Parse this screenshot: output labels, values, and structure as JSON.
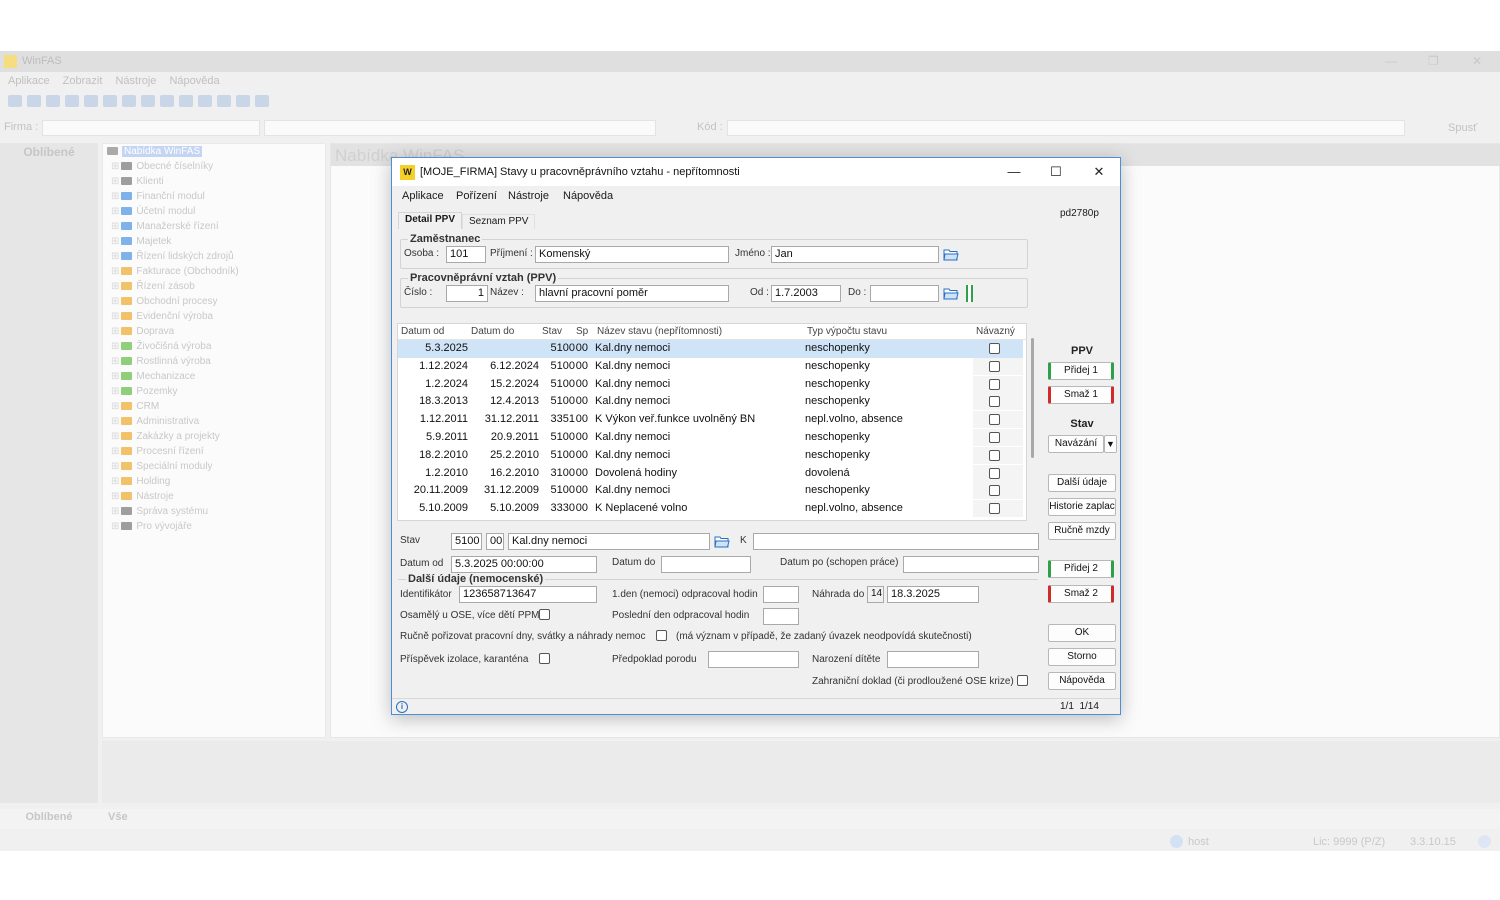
{
  "bg": {
    "title": "WinFAS",
    "menu": [
      "Aplikace",
      "Zobrazit",
      "Nástroje",
      "Nápověda"
    ],
    "firma_label": "Firma :",
    "kod_label": "Kód :",
    "spust_label": "Spusť",
    "oblibene": "Oblíbené",
    "tree_root": "Nabídka WinFAS",
    "tree": [
      {
        "label": "Obecné číselníky",
        "color": "#9e9e9e"
      },
      {
        "label": "Klienti",
        "color": "#9e9e9e"
      },
      {
        "label": "Finanční modul",
        "color": "#7fb2e8"
      },
      {
        "label": "Účetní modul",
        "color": "#7fb2e8"
      },
      {
        "label": "Manažerské řízení",
        "color": "#7fb2e8"
      },
      {
        "label": "Majetek",
        "color": "#7fb2e8"
      },
      {
        "label": "Řízení lidských zdrojů",
        "color": "#7fb2e8"
      },
      {
        "label": "Fakturace (Obchodník)",
        "color": "#f2c26b"
      },
      {
        "label": "Řízení zásob",
        "color": "#f2c26b"
      },
      {
        "label": "Obchodní procesy",
        "color": "#f2c26b"
      },
      {
        "label": "Evidenční výroba",
        "color": "#f2c26b"
      },
      {
        "label": "Doprava",
        "color": "#f2c26b"
      },
      {
        "label": "Živočišná výroba",
        "color": "#8fcf7a"
      },
      {
        "label": "Rostlinná výroba",
        "color": "#8fcf7a"
      },
      {
        "label": "Mechanizace",
        "color": "#8fcf7a"
      },
      {
        "label": "Pozemky",
        "color": "#8fcf7a"
      },
      {
        "label": "CRM",
        "color": "#f2c26b"
      },
      {
        "label": "Administrativa",
        "color": "#f2c26b"
      },
      {
        "label": "Zakázky a projekty",
        "color": "#f2c26b"
      },
      {
        "label": "Procesní řízení",
        "color": "#f2c26b"
      },
      {
        "label": "Speciální moduly",
        "color": "#f2c26b"
      },
      {
        "label": "Holding",
        "color": "#f2c26b"
      },
      {
        "label": "Nástroje",
        "color": "#f2c26b"
      },
      {
        "label": "Správa systému",
        "color": "#9e9e9e"
      },
      {
        "label": "Pro vývojáře",
        "color": "#9e9e9e"
      }
    ],
    "content_title": "Nabídka WinFAS",
    "tab_oblibene": "Oblíbené",
    "tab_vse": "Vše",
    "status_host": "host",
    "status_lic": "Lic: 9999 (P/Z)",
    "status_ver": "3.3.10.15"
  },
  "dialog": {
    "title": "[MOJE_FIRMA] Stavy u pracovněprávního vztahu - nepřítomnosti",
    "logo": "W",
    "menu": [
      "Aplikace",
      "Pořízení",
      "Nástroje",
      "Nápověda"
    ],
    "tabs": [
      "Detail PPV",
      "Seznam PPV"
    ],
    "code": "pd2780p",
    "employee": {
      "group_title": "Zaměstnanec",
      "osoba_label": "Osoba :",
      "osoba": "101",
      "prijmeni_label": "Příjmení :",
      "prijmeni": "Komenský",
      "jmeno_label": "Jméno :",
      "jmeno": "Jan"
    },
    "ppv": {
      "group_title": "Pracovněprávní vztah (PPV)",
      "cislo_label": "Číslo :",
      "cislo": "1",
      "nazev_label": "Název :",
      "nazev": "hlavní pracovní poměr",
      "od_label": "Od :",
      "od": "1.7.2003",
      "do_label": "Do :",
      "do": ""
    },
    "table": {
      "columns": [
        "Datum od",
        "Datum do",
        "Stav",
        "Sp",
        "Název stavu (nepřítomnosti)",
        "Typ výpočtu stavu",
        "Návazný"
      ],
      "rows": [
        {
          "od": "5.3.2025",
          "do": "",
          "stav": "5100",
          "sp": "00",
          "nazev": "Kal.dny nemoci",
          "typ": "neschopenky",
          "selected": true
        },
        {
          "od": "1.12.2024",
          "do": "6.12.2024",
          "stav": "5100",
          "sp": "00",
          "nazev": "Kal.dny nemoci",
          "typ": "neschopenky"
        },
        {
          "od": "1.2.2024",
          "do": "15.2.2024",
          "stav": "5100",
          "sp": "00",
          "nazev": "Kal.dny nemoci",
          "typ": "neschopenky"
        },
        {
          "od": "18.3.2013",
          "do": "12.4.2013",
          "stav": "5100",
          "sp": "00",
          "nazev": "Kal.dny nemoci",
          "typ": "neschopenky"
        },
        {
          "od": "1.12.2011",
          "do": "31.12.2011",
          "stav": "3351",
          "sp": "00",
          "nazev": "K Výkon veř.funkce uvolněný BN",
          "typ": "nepl.volno, absence"
        },
        {
          "od": "5.9.2011",
          "do": "20.9.2011",
          "stav": "5100",
          "sp": "00",
          "nazev": "Kal.dny nemoci",
          "typ": "neschopenky"
        },
        {
          "od": "18.2.2010",
          "do": "25.2.2010",
          "stav": "5100",
          "sp": "00",
          "nazev": "Kal.dny nemoci",
          "typ": "neschopenky"
        },
        {
          "od": "1.2.2010",
          "do": "16.2.2010",
          "stav": "3100",
          "sp": "00",
          "nazev": "Dovolená hodiny",
          "typ": "dovolená"
        },
        {
          "od": "20.11.2009",
          "do": "31.12.2009",
          "stav": "5100",
          "sp": "00",
          "nazev": "Kal.dny nemoci",
          "typ": "neschopenky"
        },
        {
          "od": "5.10.2009",
          "do": "5.10.2009",
          "stav": "3330",
          "sp": "00",
          "nazev": "K Neplacené volno",
          "typ": "nepl.volno, absence"
        }
      ]
    },
    "detail": {
      "stav_label": "Stav",
      "stav": "5100",
      "sp": "00",
      "stav_nazev": "Kal.dny nemoci",
      "k_label": "K",
      "k_value": "",
      "datum_od_label": "Datum od",
      "datum_od": "5.3.2025 00:00:00",
      "datum_do_label": "Datum do",
      "datum_do": "",
      "datum_po_label": "Datum po (schopen práce)",
      "datum_po": "",
      "dalsi_title": "Další údaje (nemocenské)",
      "identifikator_label": "Identifikátor",
      "identifikator": "123658713647",
      "den1_label": "1.den (nemoci) odpracoval hodin",
      "den1": "",
      "nahrada_label": "Náhrada do",
      "nahrada_num": "14",
      "nahrada_date": "18.3.2025",
      "osamely_label": "Osamělý u OSE, více dětí PPM",
      "posledni_label": "Poslední den odpracoval hodin",
      "posledni": "",
      "rucne_label": "Ručně pořizovat pracovní dny, svátky a náhrady nemoc",
      "rucne_note": "(má význam v případě, že zadaný úvazek neodpovídá skutečnosti)",
      "prispevek_label": "Příspěvek izolace, karanténa",
      "predpoklad_label": "Předpoklad porodu",
      "predpoklad": "",
      "narozeni_label": "Narození dítěte",
      "narozeni": "",
      "zahranicni_label": "Zahraniční doklad (či prodloužené OSE krize)"
    },
    "right": {
      "ppv_head": "PPV",
      "pridej1": "Přidej 1",
      "smaz1": "Smaž 1",
      "stav_head": "Stav",
      "navazani": "Navázání",
      "dalsi_udaje": "Další údaje",
      "historie": "Historie zaplac",
      "rucne_mzdy": "Ručně mzdy",
      "pridej2": "Přidej 2",
      "smaz2": "Smaž 2",
      "ok": "OK",
      "storno": "Storno",
      "napoveda": "Nápověda"
    },
    "status": {
      "info": "i",
      "pager": "1/1  1/14"
    }
  }
}
